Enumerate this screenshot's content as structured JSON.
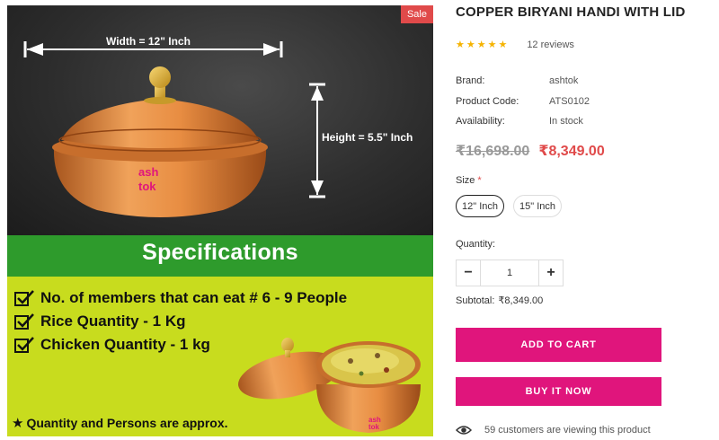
{
  "image": {
    "sale_badge": "Sale",
    "width_label": "Width = 12\" Inch",
    "height_label": "Height = 5.5\" Inch",
    "brand_mark_line1": "ash",
    "brand_mark_line2": "tok",
    "spec_title": "Specifications",
    "spec_items": [
      "No. of members that can eat # 6 - 9 People",
      "Rice Quantity - 1 Kg",
      "Chicken Quantity - 1 kg"
    ],
    "approx_note": "Quantity and Persons are approx.",
    "colors": {
      "green_band": "#2e9b2c",
      "yellow_panel": "#c8dc1e",
      "copper": "#d9843a"
    }
  },
  "product": {
    "title": "COPPER BIRYANI HANDI WITH LID",
    "rating_stars": 5,
    "reviews": "12 reviews",
    "meta": [
      {
        "key": "Brand:",
        "value": "ashtok"
      },
      {
        "key": "Product Code:",
        "value": "ATS0102"
      },
      {
        "key": "Availability:",
        "value": "In stock"
      }
    ],
    "price_old": "₹16,698.00",
    "price_new": "₹8,349.00",
    "size_label": "Size",
    "size_required": "*",
    "sizes": [
      {
        "label": "12\" Inch",
        "selected": true
      },
      {
        "label": "15\" Inch",
        "selected": false
      }
    ],
    "quantity_label": "Quantity:",
    "quantity": "1",
    "qty_minus": "−",
    "qty_plus": "+",
    "subtotal_label": "Subtotal:",
    "subtotal_value": "₹8,349.00",
    "add_to_cart": "ADD TO CART",
    "buy_now": "BUY IT NOW",
    "viewers": "59 customers are viewing this product",
    "colors": {
      "accent": "#e0157c",
      "price_new": "#e04a4a",
      "stars": "#f5b301"
    }
  }
}
